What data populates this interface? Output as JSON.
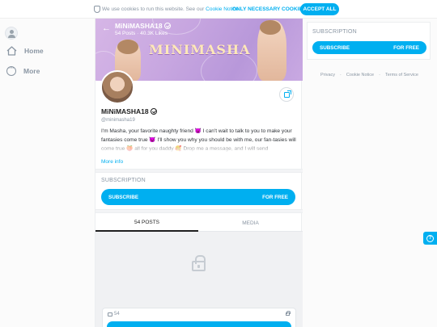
{
  "cookie_bar": {
    "message": "We use cookies to run this website. See our",
    "link_label": "Cookie Notice",
    "only_necessary_label": "ONLY NECESSARY COOKIES",
    "accept_label": "ACCEPT ALL"
  },
  "nav": {
    "home_label": "Home",
    "more_label": "More"
  },
  "banner": {
    "name": "MiNiMASHA18",
    "posts": "54 Posts",
    "likes": "40.3K Likes",
    "watermark": "MINIMASHA"
  },
  "profile": {
    "name": "MiNiMASHA18",
    "handle": "@minimasha19",
    "bio": "I'm Masha, your favorite naughty friend 😈 I can't wait to talk to you to make your fantasies come true 😈 I'll show you why you should be with me, our fan-tasies will come true 🍑 all for you daddy 🥰 Drop me a message, and I will send",
    "more_info_label": "More info"
  },
  "subscription": {
    "title": "SUBSCRIPTION",
    "button_label": "SUBSCRIBE",
    "button_price": "FOR FREE"
  },
  "tabs": {
    "posts_label": "54 POSTS",
    "media_label": "MEDIA"
  },
  "post": {
    "count": "54"
  },
  "sidebar_card": {
    "title": "SUBSCRIPTION",
    "button_label": "SUBSCRIBE",
    "button_price": "FOR FREE"
  },
  "footer": {
    "privacy": "Privacy",
    "cookie_notice": "Cookie Notice",
    "terms": "Terms of Service"
  },
  "colors": {
    "accent": "#00aff0",
    "muted_text": "#8a96a3"
  },
  "icons": [
    "shield-icon",
    "avatar-placeholder-icon",
    "home-icon",
    "more-icon",
    "back-arrow-icon",
    "verified-icon",
    "share-icon",
    "lock-icon",
    "image-icon",
    "help-icon"
  ]
}
